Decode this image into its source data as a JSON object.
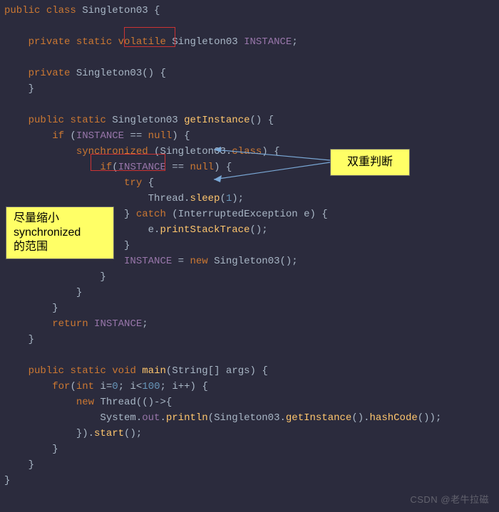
{
  "code_lines": [
    {
      "t": "public class Singleton03 {",
      "cls": "l-kw"
    },
    {
      "t": ""
    },
    {
      "t": "    private static volatile Singleton03 INSTANCE;",
      "cls": "l-kw"
    },
    {
      "t": ""
    },
    {
      "t": "    private Singleton03() {",
      "cls": "l-kw"
    },
    {
      "t": "    }"
    },
    {
      "t": ""
    },
    {
      "t": "    public static Singleton03 getInstance() {",
      "cls": "l-fn"
    },
    {
      "t": "        if (INSTANCE == null) {",
      "cls": "l-kw"
    },
    {
      "t": "            synchronized (Singleton03.class) {",
      "cls": "l-kw"
    },
    {
      "t": "                if(INSTANCE == null) {",
      "cls": "l-kw"
    },
    {
      "t": "                    try {",
      "cls": "l-kw"
    },
    {
      "t": "                        Thread.sleep(1);",
      "cls": "l-call"
    },
    {
      "t": "                    } catch (InterruptedException e) {",
      "cls": "l-kw"
    },
    {
      "t": "                        e.printStackTrace();",
      "cls": "l-call"
    },
    {
      "t": "                    }"
    },
    {
      "t": "                    INSTANCE = new Singleton03();",
      "cls": "l-kw"
    },
    {
      "t": "                }"
    },
    {
      "t": "            }"
    },
    {
      "t": "        }"
    },
    {
      "t": "        return INSTANCE;",
      "cls": "l-kw"
    },
    {
      "t": "    }"
    },
    {
      "t": ""
    },
    {
      "t": "    public static void main(String[] args) {",
      "cls": "l-fn"
    },
    {
      "t": "        for(int i=0; i<100; i++) {",
      "cls": "l-kw"
    },
    {
      "t": "            new Thread(()->{",
      "cls": "l-kw"
    },
    {
      "t": "                System.out.println(Singleton03.getInstance().hashCode());",
      "cls": "l-call"
    },
    {
      "t": "            }).start();",
      "cls": "l-call"
    },
    {
      "t": "        }"
    },
    {
      "t": "    }"
    },
    {
      "t": "}"
    }
  ],
  "annotations": {
    "left_note": "尽量缩小\nsynchronized\n的范围",
    "right_note": "双重判断"
  },
  "highlights": {
    "volatile": "volatile",
    "synchronized": "synchronized"
  },
  "watermark": "CSDN @老牛拉磁"
}
